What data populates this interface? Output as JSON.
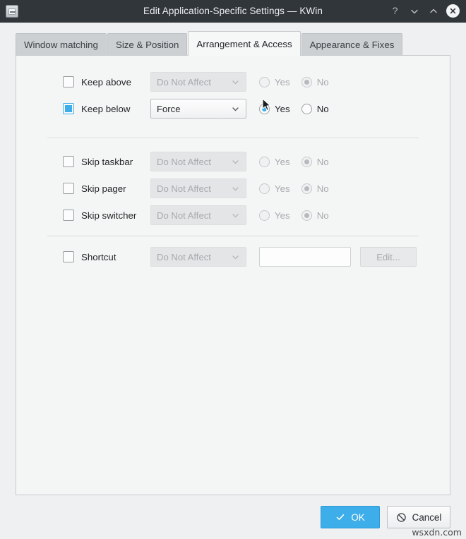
{
  "window": {
    "title": "Edit Application-Specific Settings — KWin",
    "icon": "app-window-icon",
    "titlebar_buttons": [
      {
        "name": "help",
        "glyph": "?"
      },
      {
        "name": "minimize",
        "glyph": "v"
      },
      {
        "name": "maximize",
        "glyph": "^"
      },
      {
        "name": "close",
        "glyph": "X"
      }
    ]
  },
  "tabs": [
    {
      "label": "Window matching",
      "active": false
    },
    {
      "label": "Size & Position",
      "active": false
    },
    {
      "label": "Arrangement & Access",
      "active": true
    },
    {
      "label": "Appearance & Fixes",
      "active": false
    }
  ],
  "rows": [
    {
      "label": "Keep above",
      "checked": false,
      "combo_value": "Do Not Affect",
      "combo_disabled": true,
      "yes_label": "Yes",
      "no_label": "No",
      "selected": "No",
      "radios_disabled": true
    },
    {
      "label": "Keep below",
      "checked": true,
      "combo_value": "Force",
      "combo_disabled": false,
      "yes_label": "Yes",
      "no_label": "No",
      "selected": "Yes",
      "radios_disabled": false
    },
    {
      "label": "Skip taskbar",
      "checked": false,
      "combo_value": "Do Not Affect",
      "combo_disabled": true,
      "yes_label": "Yes",
      "no_label": "No",
      "selected": "No",
      "radios_disabled": true
    },
    {
      "label": "Skip pager",
      "checked": false,
      "combo_value": "Do Not Affect",
      "combo_disabled": true,
      "yes_label": "Yes",
      "no_label": "No",
      "selected": "No",
      "radios_disabled": true
    },
    {
      "label": "Skip switcher",
      "checked": false,
      "combo_value": "Do Not Affect",
      "combo_disabled": true,
      "yes_label": "Yes",
      "no_label": "No",
      "selected": "No",
      "radios_disabled": true
    }
  ],
  "shortcut_row": {
    "label": "Shortcut",
    "checked": false,
    "combo_value": "Do Not Affect",
    "combo_disabled": true,
    "field_value": "",
    "field_placeholder": "",
    "edit_label": "Edit...",
    "edit_disabled": true
  },
  "buttons": {
    "ok_label": "OK",
    "cancel_label": "Cancel"
  },
  "colors": {
    "titlebar": "#31363b",
    "accent": "#3daee9",
    "dialog_bg": "#eff0f1",
    "panel_bg": "#f4f5f5",
    "tab_inactive": "#cdd0d2"
  },
  "watermark": "wsxdn.com"
}
